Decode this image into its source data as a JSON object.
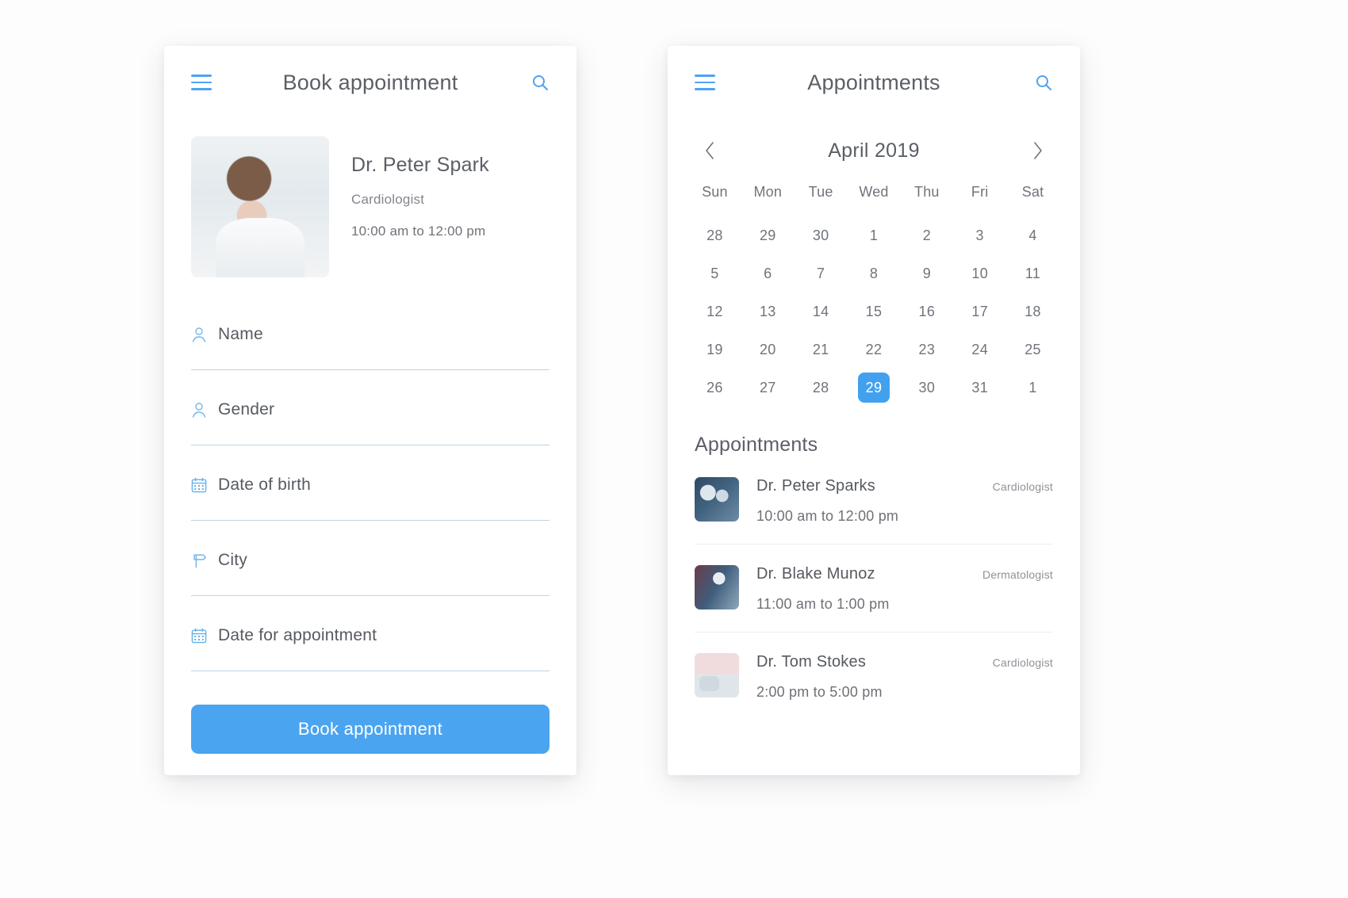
{
  "theme": {
    "accent": "#4ba4f0",
    "accent_selected": "#42a1ef",
    "text": "#5b5f66",
    "muted": "#8d9197",
    "underline": "#bcd4e2"
  },
  "left_screen": {
    "topbar": {
      "menu_icon": "hamburger-menu-icon",
      "title": "Book appointment",
      "search_icon": "search-icon"
    },
    "doctor": {
      "photo": "doctor-portrait",
      "name": "Dr. Peter Spark",
      "specialty": "Cardiologist",
      "time": "10:00 am to 12:00 pm"
    },
    "fields": [
      {
        "icon": "user-icon",
        "label": "Name"
      },
      {
        "icon": "user-icon",
        "label": "Gender"
      },
      {
        "icon": "calendar-icon",
        "label": "Date of birth"
      },
      {
        "icon": "signpost-icon",
        "label": "City"
      },
      {
        "icon": "calendar-icon",
        "label": "Date for appointment"
      }
    ],
    "submit_label": "Book appointment"
  },
  "right_screen": {
    "topbar": {
      "menu_icon": "hamburger-menu-icon",
      "title": "Appointments",
      "search_icon": "search-icon"
    },
    "calendar": {
      "prev_icon": "chevron-left-icon",
      "month_label": "April 2019",
      "next_icon": "chevron-right-icon",
      "day_names": [
        "Sun",
        "Mon",
        "Tue",
        "Wed",
        "Thu",
        "Fri",
        "Sat"
      ],
      "weeks": [
        [
          {
            "d": "28",
            "o": true
          },
          {
            "d": "29",
            "o": true
          },
          {
            "d": "30",
            "o": true
          },
          {
            "d": "1"
          },
          {
            "d": "2"
          },
          {
            "d": "3"
          },
          {
            "d": "4"
          }
        ],
        [
          {
            "d": "5"
          },
          {
            "d": "6"
          },
          {
            "d": "7"
          },
          {
            "d": "8"
          },
          {
            "d": "9"
          },
          {
            "d": "10"
          },
          {
            "d": "11"
          }
        ],
        [
          {
            "d": "12"
          },
          {
            "d": "13"
          },
          {
            "d": "14"
          },
          {
            "d": "15"
          },
          {
            "d": "16"
          },
          {
            "d": "17"
          },
          {
            "d": "18"
          }
        ],
        [
          {
            "d": "19"
          },
          {
            "d": "20"
          },
          {
            "d": "21"
          },
          {
            "d": "22"
          },
          {
            "d": "23"
          },
          {
            "d": "24"
          },
          {
            "d": "25"
          }
        ],
        [
          {
            "d": "26"
          },
          {
            "d": "27"
          },
          {
            "d": "28"
          },
          {
            "d": "29",
            "selected": true
          },
          {
            "d": "30"
          },
          {
            "d": "31"
          },
          {
            "d": "1",
            "o": true
          }
        ]
      ],
      "selected_day": "29"
    },
    "appointments_title": "Appointments",
    "appointments": [
      {
        "thumb": "surgery-photo",
        "name": "Dr. Peter Sparks",
        "time": "10:00 am to 12:00 pm",
        "specialty": "Cardiologist"
      },
      {
        "thumb": "surgery-photo-2",
        "name": "Dr. Blake Munoz",
        "time": "11:00 am to 1:00 pm",
        "specialty": "Dermatologist"
      },
      {
        "thumb": "room-photo",
        "name": "Dr. Tom Stokes",
        "time": "2:00 pm to 5:00 pm",
        "specialty": "Cardiologist"
      }
    ]
  }
}
